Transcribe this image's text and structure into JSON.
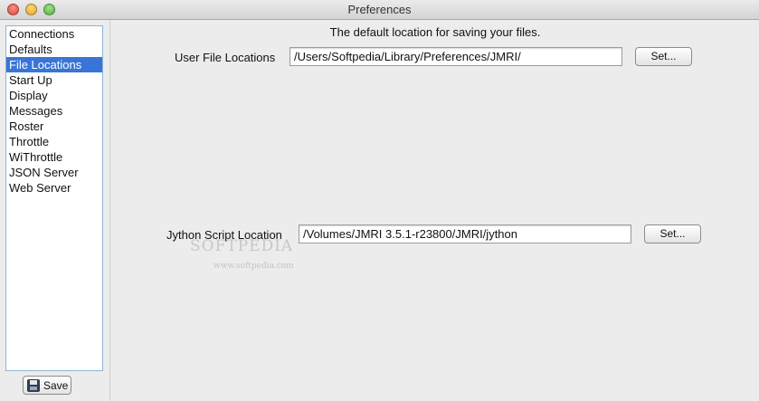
{
  "window": {
    "title": "Preferences"
  },
  "sidebar": {
    "items": [
      {
        "label": "Connections"
      },
      {
        "label": "Defaults"
      },
      {
        "label": "File Locations",
        "selected": true
      },
      {
        "label": "Start Up"
      },
      {
        "label": "Display"
      },
      {
        "label": "Messages"
      },
      {
        "label": "Roster"
      },
      {
        "label": "Throttle"
      },
      {
        "label": "WiThrottle"
      },
      {
        "label": "JSON Server"
      },
      {
        "label": "Web Server"
      }
    ],
    "save_label": "Save",
    "save_icon": "floppy-disk-icon"
  },
  "main": {
    "description": "The default location for saving your files.",
    "user_files": {
      "label": "User File Locations",
      "value": "/Users/Softpedia/Library/Preferences/JMRI/",
      "set_label": "Set..."
    },
    "jython": {
      "label": "Jython Script Location",
      "value": "/Volumes/JMRI 3.5.1-r23800/JMRI/jython",
      "set_label": "Set..."
    }
  },
  "watermark": {
    "text": "SOFTPEDIA",
    "sub": "www.softpedia.com"
  },
  "colors": {
    "selection": "#3875d7",
    "list_border": "#8fb3d9"
  }
}
